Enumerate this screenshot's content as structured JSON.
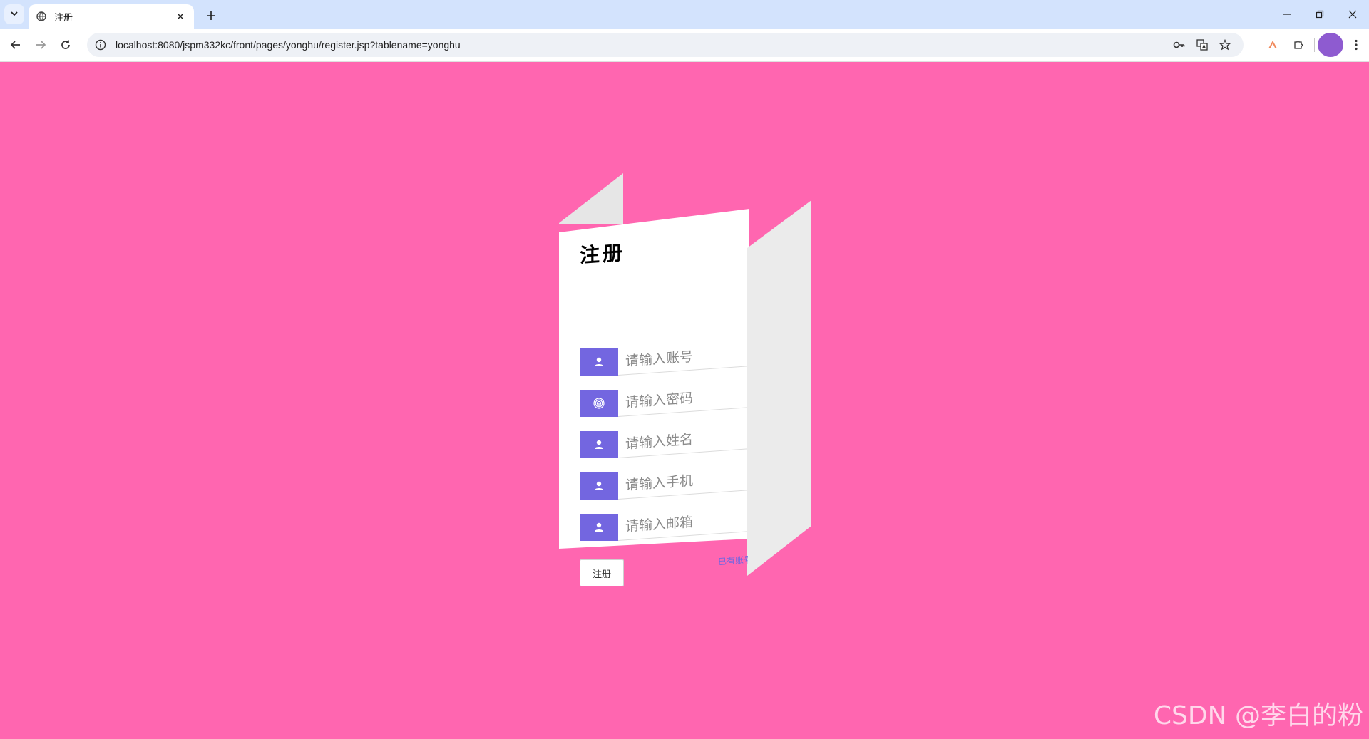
{
  "browser": {
    "tab_title": "注册",
    "url": "localhost:8080/jspm332kc/front/pages/yonghu/register.jsp?tablename=yonghu",
    "icons": {
      "tab_search": "chevron-down-icon",
      "favicon": "globe-icon",
      "tab_close": "close-icon",
      "new_tab": "plus-icon",
      "back": "arrow-left-icon",
      "forward": "arrow-right-icon",
      "reload": "reload-icon",
      "site_info": "info-icon",
      "password": "key-icon",
      "translate": "translate-icon",
      "bookmark": "star-icon",
      "extension_1": "extension-icon",
      "extensions": "puzzle-icon",
      "profile": "avatar",
      "menu": "kebab-menu-icon",
      "minimize": "minimize-icon",
      "restore": "restore-icon",
      "close_window": "close-icon"
    }
  },
  "form": {
    "title": "注册",
    "fields": [
      {
        "placeholder": "请输入账号",
        "icon": "user-icon"
      },
      {
        "placeholder": "请输入密码",
        "icon": "fingerprint-icon"
      },
      {
        "placeholder": "请输入姓名",
        "icon": "user-icon"
      },
      {
        "placeholder": "请输入手机",
        "icon": "user-icon"
      },
      {
        "placeholder": "请输入邮箱",
        "icon": "user-icon"
      }
    ],
    "submit_label": "注册",
    "login_link": "已有账号"
  },
  "colors": {
    "background": "#ff66b0",
    "accent": "#7366e0",
    "card": "#ffffff",
    "fold": "#ebebeb"
  },
  "watermark": "CSDN @李白的粉"
}
